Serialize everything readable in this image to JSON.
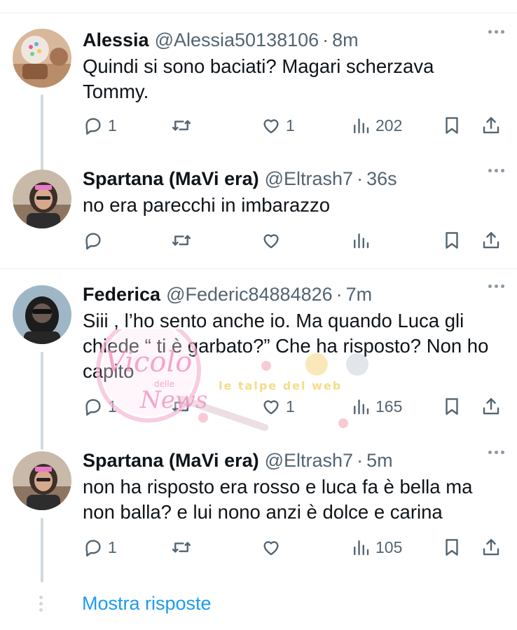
{
  "tweets": [
    {
      "name": "Alessia",
      "handle": "@Alessia50138106",
      "separator": "·",
      "time": "8m",
      "text": "Quindi si sono baciati? Magari scherzava Tommy.",
      "counts": {
        "reply": "1",
        "retweet": "",
        "like": "1",
        "views": "202"
      },
      "avatar": "alessia-avatar"
    },
    {
      "name": "Spartana (MaVi era)",
      "handle": "@Eltrash7",
      "separator": "·",
      "time": "36s",
      "text": "no era parecchi in imbarazzo",
      "counts": {
        "reply": "",
        "retweet": "",
        "like": "",
        "views": ""
      },
      "avatar": "spartana-avatar"
    },
    {
      "name": "Federica",
      "handle": "@Federic84884826",
      "separator": "·",
      "time": "7m",
      "text": "Siii , l’ho sento anche io. Ma quando Luca gli chiede “ ti è garbato?” Che ha risposto? Non ho capito",
      "counts": {
        "reply": "1",
        "retweet": "",
        "like": "1",
        "views": "165"
      },
      "avatar": "federica-avatar"
    },
    {
      "name": "Spartana (MaVi era)",
      "handle": "@Eltrash7",
      "separator": "·",
      "time": "5m",
      "text": "non ha risposto era rosso e luca fa è bella ma non balla? e lui nono anzi è dolce e carina",
      "counts": {
        "reply": "1",
        "retweet": "",
        "like": "",
        "views": "105"
      },
      "avatar": "spartana-avatar"
    }
  ],
  "show_replies": "Mostra risposte",
  "watermark": {
    "main": "Vicolo",
    "small": "delle",
    "sub": "News",
    "banner": "le talpe del web"
  },
  "colors": {
    "text": "#0f1419",
    "secondary": "#536471",
    "link": "#1d9bf0",
    "thread_line": "#cfd9de",
    "divider": "#eff3f4"
  },
  "icons": [
    "reply-icon",
    "retweet-icon",
    "like-icon",
    "views-icon",
    "bookmark-icon",
    "share-icon",
    "more-icon"
  ]
}
